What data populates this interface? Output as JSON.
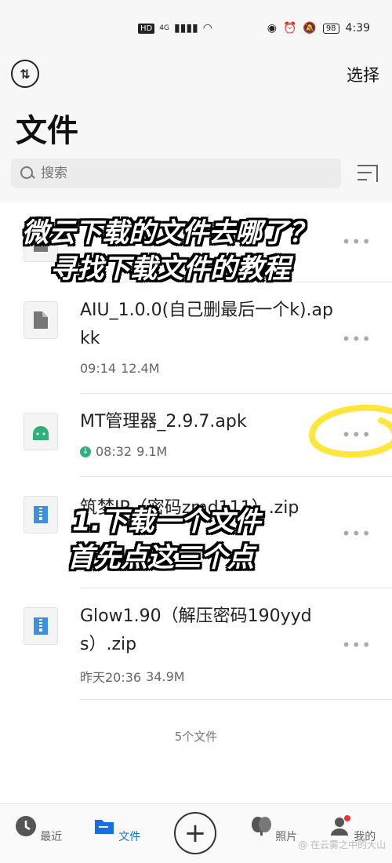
{
  "status_bar": {
    "network_badge": "HD",
    "signal_label": "4G",
    "battery": "98",
    "time": "4:39"
  },
  "header": {
    "select_label": "选择",
    "title": "文件",
    "search_placeholder": "搜索"
  },
  "files": [
    {
      "name": "",
      "meta_time": "",
      "meta_size": "",
      "icon": "generic-file-icon"
    },
    {
      "name": "AIU_1.0.0(自己删最后一个k).apkk",
      "meta_time": "09:14",
      "meta_size": "12.4M",
      "icon": "generic-file-icon"
    },
    {
      "name": "MT管理器_2.9.7.apk",
      "meta_time": "08:32",
      "meta_size": "9.1M",
      "icon": "android-icon",
      "downloaded": true
    },
    {
      "name": "筑梦IP（密码zmd111）.zip",
      "meta_time": "",
      "meta_size": "",
      "icon": "zip-icon"
    },
    {
      "name": "Glow1.90（解压密码190yyds）.zip",
      "meta_time": "昨天20:36",
      "meta_size": "34.9M",
      "icon": "zip-icon"
    }
  ],
  "footer_count": "5个文件",
  "overlays": {
    "title_line1": "微云下载的文件去哪了？",
    "title_line2": "寻找下载文件的教程",
    "step_line1": "1.下载一个文件",
    "step_line2": "首先点这三个点"
  },
  "bottom_nav": {
    "recent": "最近",
    "files": "文件",
    "photos": "照片",
    "mine": "我的"
  },
  "watermark": "@ 在云雾之中的大山",
  "colors": {
    "accent": "#1a6fe0",
    "download_green": "#2eb07a",
    "highlight_yellow": "#ffe63c"
  }
}
